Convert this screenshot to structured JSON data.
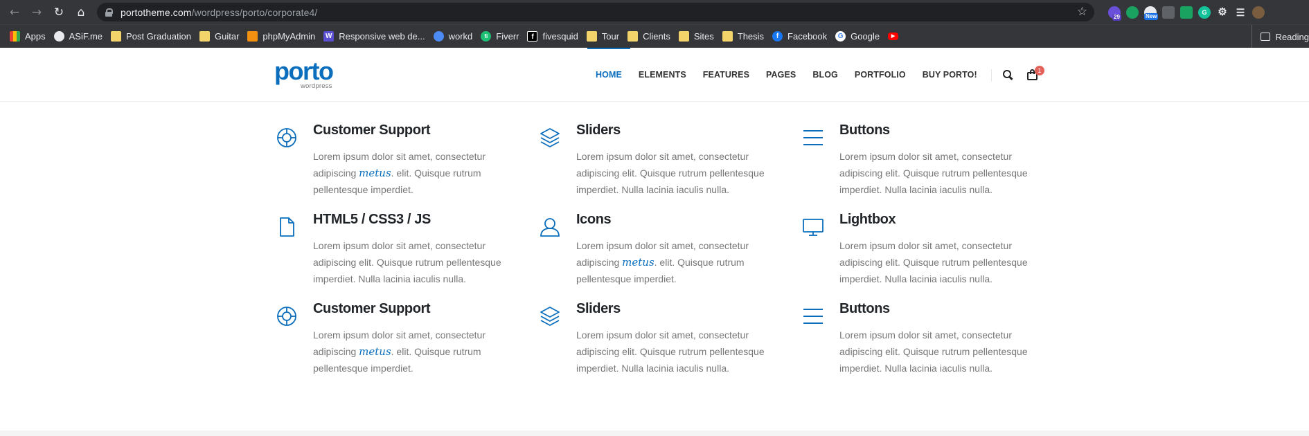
{
  "browser": {
    "url_host": "portotheme.com",
    "url_path": "/wordpress/porto/corporate4/",
    "extension_badges": {
      "count": "29",
      "new": "New"
    },
    "bookmarks": [
      {
        "label": "Apps",
        "icon": "apps-grid-icon",
        "color": "#ea4335"
      },
      {
        "label": "ASiF.me",
        "icon": "globe-icon",
        "color": "#e8eaed"
      },
      {
        "label": "Post Graduation",
        "icon": "folder-icon",
        "color": "#f2d46b"
      },
      {
        "label": "Guitar",
        "icon": "folder-icon",
        "color": "#f2d46b"
      },
      {
        "label": "phpMyAdmin",
        "icon": "phpmyadmin-icon",
        "color": "#f29111"
      },
      {
        "label": "Responsive web de...",
        "icon": "w-icon",
        "color": "#5a4fcf"
      },
      {
        "label": "workd",
        "icon": "workd-icon",
        "color": "#4c8bf5"
      },
      {
        "label": "Fiverr",
        "icon": "fiverr-icon",
        "color": "#1dbf73"
      },
      {
        "label": "fivesquid",
        "icon": "f-square-icon",
        "color": "#000000"
      },
      {
        "label": "Tour",
        "icon": "folder-icon",
        "color": "#f2d46b"
      },
      {
        "label": "Clients",
        "icon": "folder-icon",
        "color": "#f2d46b"
      },
      {
        "label": "Sites",
        "icon": "folder-icon",
        "color": "#f2d46b"
      },
      {
        "label": "Thesis",
        "icon": "folder-icon",
        "color": "#f2d46b"
      },
      {
        "label": "Facebook",
        "icon": "facebook-icon",
        "color": "#1877f2"
      },
      {
        "label": "Google",
        "icon": "google-icon",
        "color": "#ffffff"
      },
      {
        "label": "",
        "icon": "youtube-icon",
        "color": "#ff0000"
      }
    ],
    "reading_list": "Reading"
  },
  "site": {
    "logo_text": "porto",
    "logo_sub": "wordpress",
    "brand_color": "#0a6ebd",
    "menu": [
      "HOME",
      "ELEMENTS",
      "FEATURES",
      "PAGES",
      "BLOG",
      "PORTFOLIO",
      "BUY PORTO!"
    ],
    "cart_count": "1"
  },
  "features": [
    {
      "title": "Customer Support",
      "icon": "lifebuoy-icon",
      "pre": "Lorem ipsum dolor sit amet, consectetur adipiscing ",
      "script": "metus",
      "post": ". elit. Quisque rutrum pellentesque imperdiet."
    },
    {
      "title": "Sliders",
      "icon": "layers-icon",
      "pre": "Lorem ipsum dolor sit amet, consectetur adipiscing elit. Quisque rutrum pellentesque imperdiet. Nulla lacinia iaculis nulla.",
      "script": "",
      "post": ""
    },
    {
      "title": "Buttons",
      "icon": "menu-lines-icon",
      "pre": "Lorem ipsum dolor sit amet, consectetur adipiscing elit. Quisque rutrum pellentesque imperdiet. Nulla lacinia iaculis nulla.",
      "script": "",
      "post": ""
    },
    {
      "title": "HTML5 / CSS3 / JS",
      "icon": "document-icon",
      "pre": "Lorem ipsum dolor sit amet, consectetur adipiscing elit. Quisque rutrum pellentesque imperdiet. Nulla lacinia iaculis nulla.",
      "script": "",
      "post": ""
    },
    {
      "title": "Icons",
      "icon": "user-icon",
      "pre": "Lorem ipsum dolor sit amet, consectetur adipiscing ",
      "script": "metus",
      "post": ". elit. Quisque rutrum pellentesque imperdiet."
    },
    {
      "title": "Lightbox",
      "icon": "monitor-icon",
      "pre": "Lorem ipsum dolor sit amet, consectetur adipiscing elit. Quisque rutrum pellentesque imperdiet. Nulla lacinia iaculis nulla.",
      "script": "",
      "post": ""
    },
    {
      "title": "Customer Support",
      "icon": "lifebuoy-icon",
      "pre": "Lorem ipsum dolor sit amet, consectetur adipiscing ",
      "script": "metus",
      "post": ". elit. Quisque rutrum pellentesque imperdiet."
    },
    {
      "title": "Sliders",
      "icon": "layers-icon",
      "pre": "Lorem ipsum dolor sit amet, consectetur adipiscing elit. Quisque rutrum pellentesque imperdiet. Nulla lacinia iaculis nulla.",
      "script": "",
      "post": ""
    },
    {
      "title": "Buttons",
      "icon": "menu-lines-icon",
      "pre": "Lorem ipsum dolor sit amet, consectetur adipiscing elit. Quisque rutrum pellentesque imperdiet. Nulla lacinia iaculis nulla.",
      "script": "",
      "post": ""
    }
  ]
}
